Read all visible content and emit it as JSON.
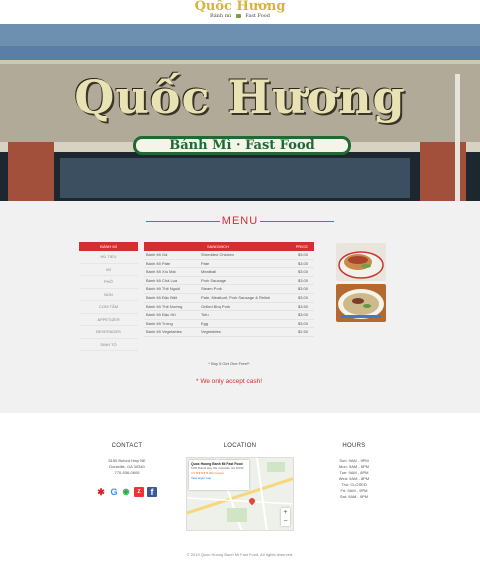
{
  "brand": {
    "logo_main": "Quốc Hương",
    "logo_sub_left": "Bánh mì",
    "logo_sub_right": "Fast Food",
    "accent_color": "#d32f2f",
    "logo_color": "#d8b33a"
  },
  "hero": {
    "sign_title": "Quốc Hương",
    "sign_sub": "Bánh Mì · Fast Food"
  },
  "menu": {
    "heading": "MENU",
    "categories_header": "BÁNH MÌ",
    "categories": [
      "HỦ TIẾU",
      "MÌ",
      "PHỞ",
      "BÚN",
      "CƠM TẤM",
      "APPETIZER",
      "BEVERAGES",
      "SINH TỐ"
    ],
    "table_headers": [
      "",
      "SANDWICH",
      "PRICE"
    ],
    "items": [
      {
        "name": "Bánh Mì Gà",
        "desc": "Shredded Chicken",
        "price": "$3.00"
      },
      {
        "name": "Bánh Mì Pate",
        "desc": "Pate",
        "price": "$3.00"
      },
      {
        "name": "Bánh Mì Xíu Mại",
        "desc": "Meatball",
        "price": "$3.00"
      },
      {
        "name": "Bánh Mì Chả Lụa",
        "desc": "Pork Sausage",
        "price": "$3.00"
      },
      {
        "name": "Bánh Mì Thịt Nguội",
        "desc": "Steam Pork",
        "price": "$3.00"
      },
      {
        "name": "Bánh Mì Đặc Biệt",
        "desc": "Pate, Meatloaf, Pork Sausage & Relish",
        "price": "$3.00"
      },
      {
        "name": "Bánh Mì Thịt Nướng",
        "desc": "Grilled Bbq Pork",
        "price": "$3.50"
      },
      {
        "name": "Bánh Mì Đậu Hũ",
        "desc": "Tofu",
        "price": "$3.00"
      },
      {
        "name": "Bánh Mì Trứng",
        "desc": "Egg",
        "price": "$3.00"
      },
      {
        "name": "Bánh Mì Vegetables",
        "desc": "Vegetables",
        "price": "$2.50"
      }
    ],
    "note": "* Buy 5 Get One Free!*",
    "cash_note": "* We only accept cash!"
  },
  "footer": {
    "contact_title": "CONTACT",
    "address_line1": "5150 Buford Hwy NE",
    "address_line2": "Doraville, GA 30340",
    "phone": "770-936-0605",
    "social": [
      "yelp-icon",
      "google-icon",
      "tripadvisor-icon",
      "zagat-icon",
      "facebook-icon"
    ],
    "location_title": "LOCATION",
    "map": {
      "place_name": "Quoc Huong Banh Mi Fast Food",
      "place_address": "5150 Buford Hwy NE, Doraville, GA 30340",
      "rating": "4.5 ★★★★★",
      "reviews": "400 reviews",
      "link": "View larger map",
      "zoom_in": "+",
      "zoom_out": "−"
    },
    "hours_title": "HOURS",
    "hours": [
      "Sun: 9AM - 9PM",
      "Mon: 9AM - 8PM",
      "Tue: 9AM - 8PM",
      "Wed: 9AM - 8PM",
      "Thu: CLOSED",
      "Fri: 9AM - 9PM",
      "Sat: 9AM - 9PM"
    ],
    "copyright": "© 2019 Quoc Huong Banh Mi Fast Food. All rights reserved."
  }
}
